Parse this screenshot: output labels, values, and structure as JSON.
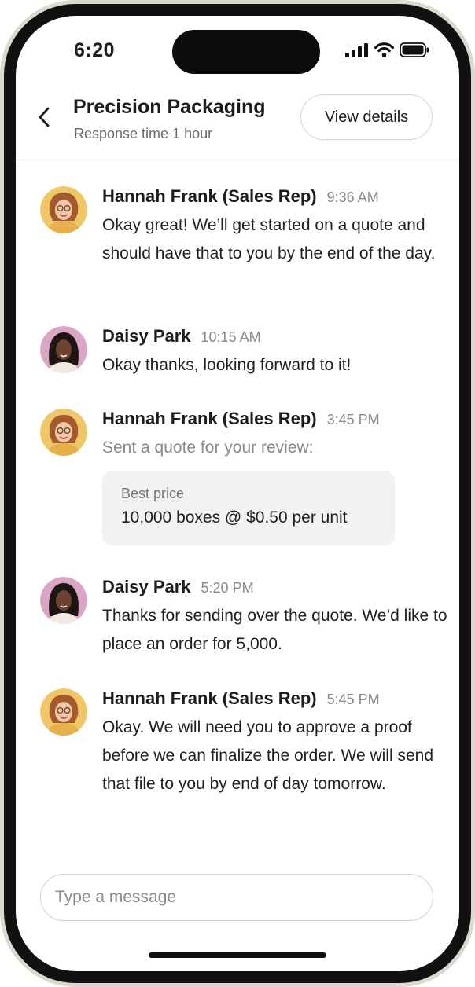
{
  "status_bar": {
    "time": "6:20"
  },
  "header": {
    "title": "Precision Packaging",
    "subtitle": "Response time 1 hour",
    "view_details_label": "View details"
  },
  "messages": [
    {
      "name": "Hannah Frank (Sales Rep)",
      "time": "9:36 AM",
      "text": "Okay great! We’ll get started on a quote and should have that to you by the end of the day."
    },
    {
      "name": "Daisy Park",
      "time": "10:15 AM",
      "text": "Okay thanks, looking forward to it!"
    },
    {
      "name": "Hannah Frank (Sales Rep)",
      "time": "3:45 PM",
      "text": "Sent a quote for your review:",
      "quote": {
        "label": "Best price",
        "value": "10,000 boxes @ $0.50 per unit"
      }
    },
    {
      "name": "Daisy Park",
      "time": "5:20 PM",
      "text": "Thanks for sending over the quote. We’d like to place an order for 5,000."
    },
    {
      "name": "Hannah Frank (Sales Rep)",
      "time": "5:45 PM",
      "text": "Okay. We will need you to approve a proof before we can finalize the order. We will send that file to you by end of day tomorrow."
    }
  ],
  "composer": {
    "placeholder": "Type a message"
  },
  "icons": {
    "back": "chevron-left-icon",
    "signal": "cellular-signal-icon",
    "wifi": "wifi-icon",
    "battery": "battery-icon"
  },
  "colors": {
    "hannah_avatar_bg": "#f0c767",
    "daisy_avatar_bg": "#d9a7c4",
    "quote_card_bg": "#f2f2f2"
  }
}
